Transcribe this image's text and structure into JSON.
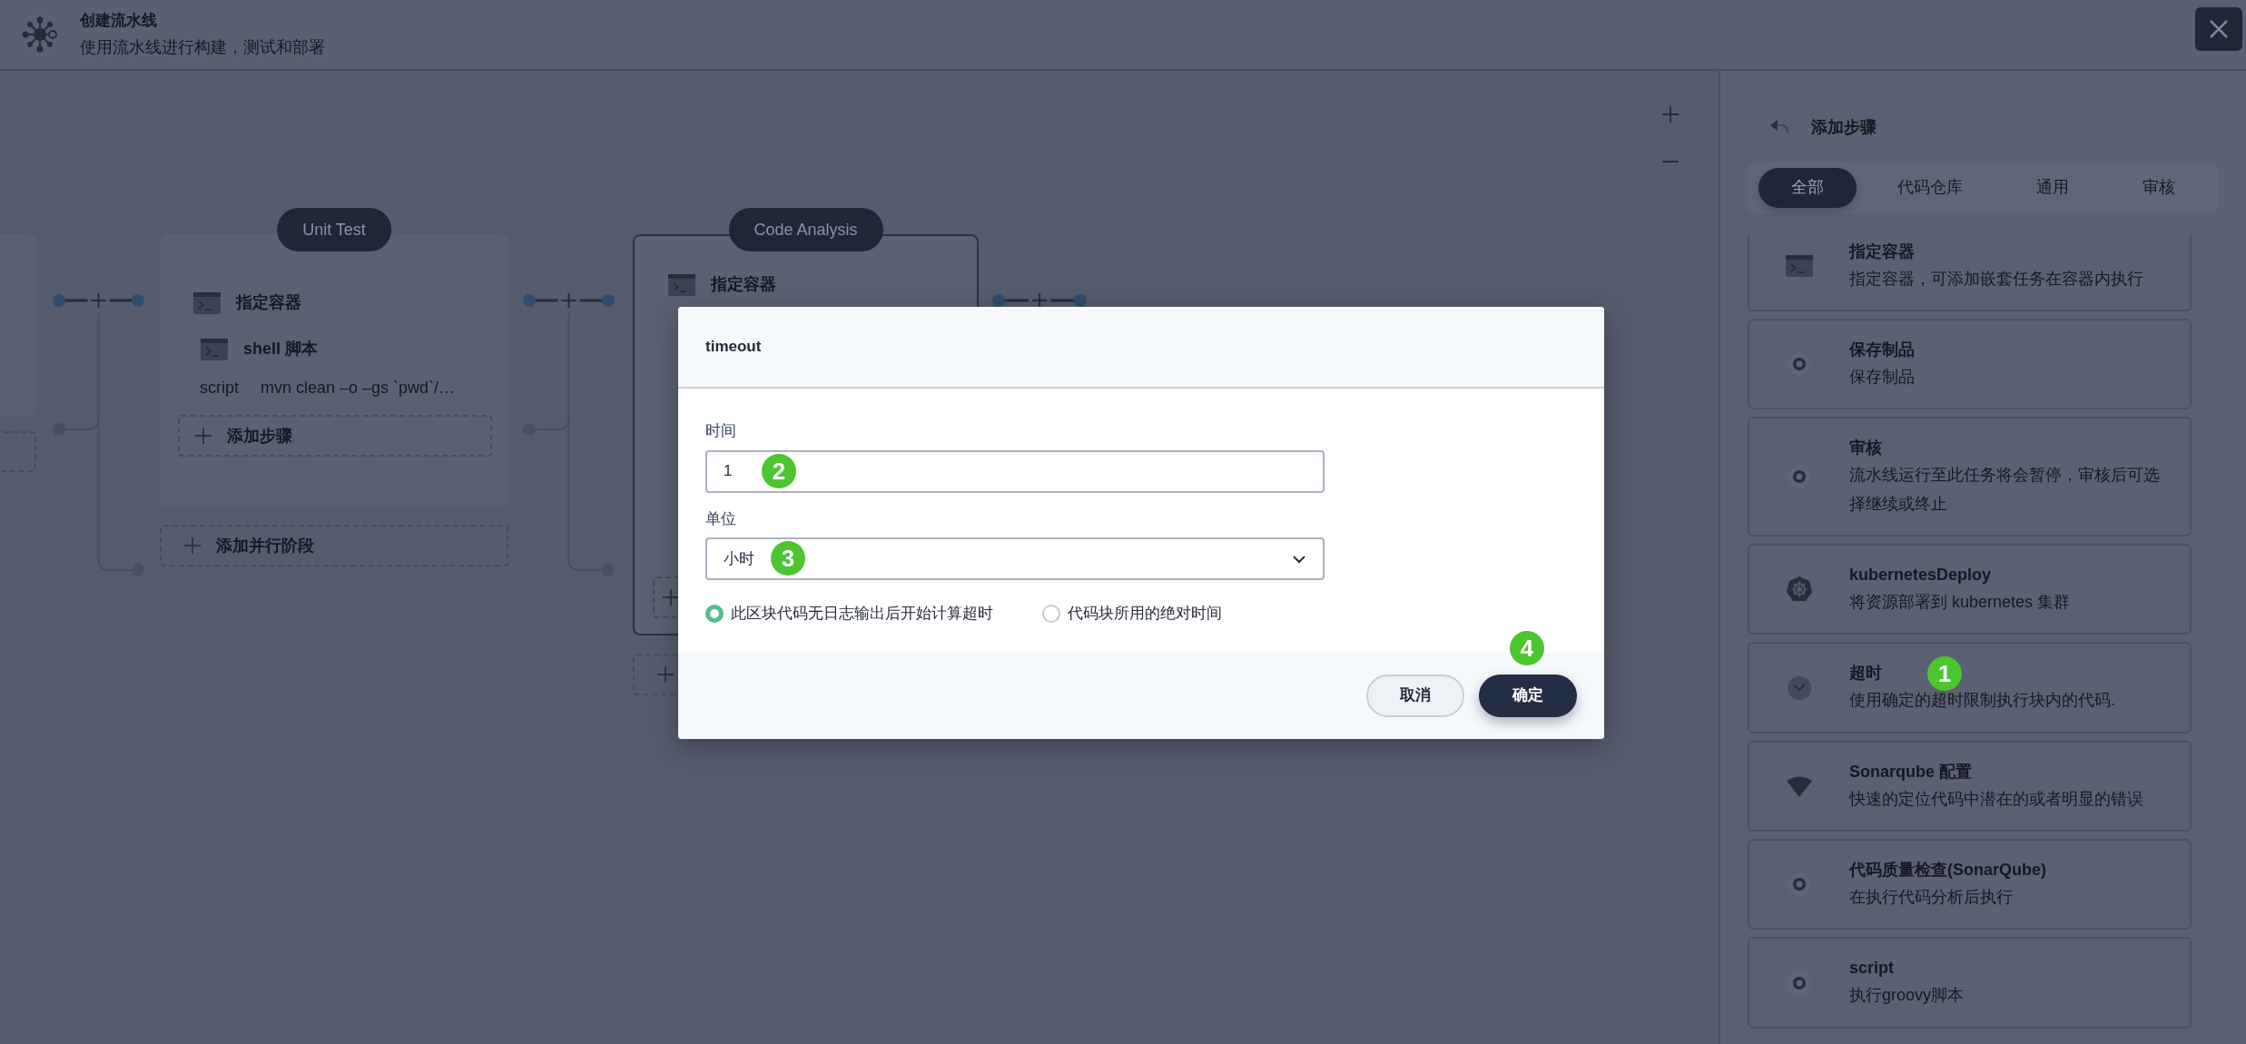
{
  "header": {
    "title": "创建流水线",
    "subtitle": "使用流水线进行构建，测试和部署"
  },
  "canvas": {
    "stages": [
      {
        "label": "Unit Test",
        "selected": false,
        "container": "指定容器",
        "steps": [
          {
            "title": "shell 脚本",
            "key": "script",
            "value": "mvn clean –o –gs `pwd`/…"
          }
        ],
        "add_step": "添加步骤"
      },
      {
        "label": "Code Analysis",
        "selected": true,
        "container": "指定容器"
      }
    ],
    "add_parallel": "添加并行阶段"
  },
  "panel": {
    "title": "添加步骤",
    "tabs": [
      {
        "label": "全部",
        "selected": true
      },
      {
        "label": "代码仓库",
        "selected": false
      },
      {
        "label": "通用",
        "selected": false
      },
      {
        "label": "审核",
        "selected": false
      }
    ],
    "items": [
      {
        "kind": "terminal",
        "title": "指定容器",
        "description": "指定容器，可添加嵌套任务在容器内执行"
      },
      {
        "kind": "dot",
        "title": "保存制品",
        "description": "保存制品"
      },
      {
        "kind": "dot",
        "title": "审核",
        "description": "流水线运行至此任务将会暂停，审核后可选择继续或终止"
      },
      {
        "kind": "kubernetes",
        "title": "kubernetesDeploy",
        "description": "将资源部署到 kubernetes 集群"
      },
      {
        "kind": "check",
        "title": "超时",
        "description": "使用确定的超时限制执行块内的代码.",
        "callout": "1"
      },
      {
        "kind": "sonar",
        "title": "Sonarqube 配置",
        "description": "快速的定位代码中潜在的或者明显的错误"
      },
      {
        "kind": "dot",
        "title": "代码质量检查(SonarQube)",
        "description": "在执行代码分析后执行"
      },
      {
        "kind": "dot",
        "title": "script",
        "description": "执行groovy脚本"
      }
    ]
  },
  "dialog": {
    "title": "timeout",
    "fields": [
      {
        "kind": "input",
        "label": "时间",
        "value": "1",
        "callout": "2"
      },
      {
        "kind": "select",
        "label": "单位",
        "value": "小时",
        "callout": "3"
      }
    ],
    "options": [
      {
        "label": "此区块代码无日志输出后开始计算超时",
        "selected": true
      },
      {
        "label": "代码块所用的绝对时间",
        "selected": false
      }
    ],
    "buttons": [
      {
        "kind": "secondary",
        "label": "取消"
      },
      {
        "kind": "primary",
        "label": "确定",
        "callout": "4"
      }
    ]
  }
}
